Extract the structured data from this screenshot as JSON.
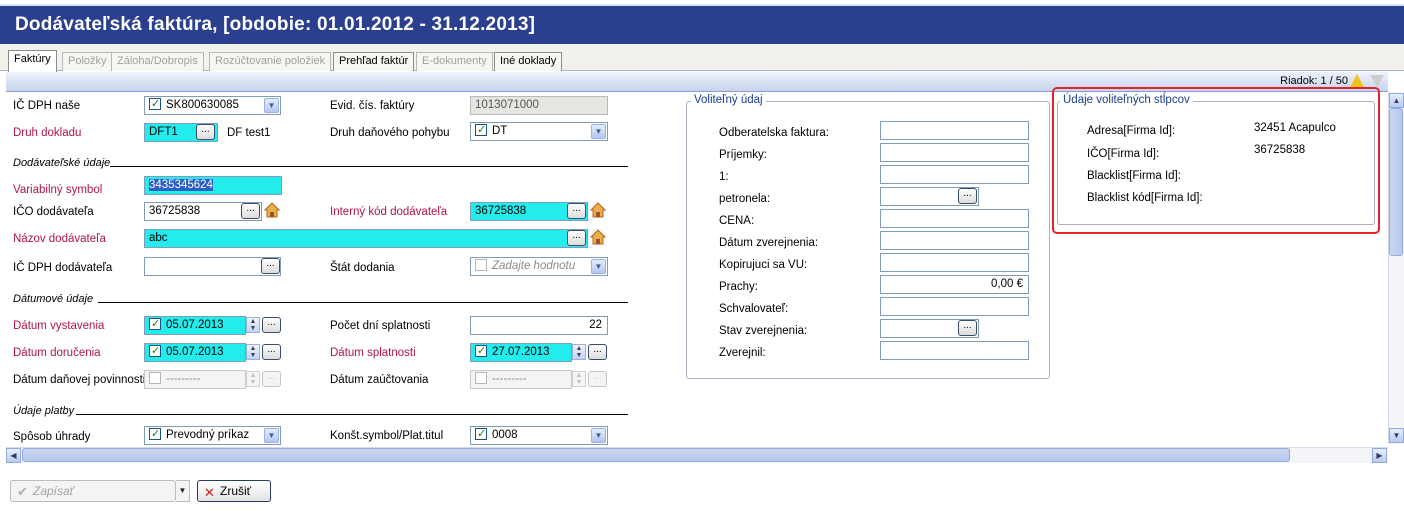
{
  "window": {
    "title": "Dodávateľská faktúra, [obdobie: 01.01.2012 - 31.12.2013]"
  },
  "tabs": [
    {
      "label": "Faktúry",
      "state": "active"
    },
    {
      "label": "Položky",
      "state": "disabled"
    },
    {
      "label": "Záloha/Dobropis",
      "state": "disabled"
    },
    {
      "label": "Rozúčtovanie položiek",
      "state": "disabled"
    },
    {
      "label": "Prehľad faktúr",
      "state": "enabled"
    },
    {
      "label": "E-dokumenty",
      "state": "disabled"
    },
    {
      "label": "Iné doklady",
      "state": "enabled"
    }
  ],
  "toolbar": {
    "row_info": "Riadok: 1 / 50",
    "icons": [
      "warning-icon",
      "filter-icon"
    ]
  },
  "form": {
    "ic_dph_nase": {
      "label": "IČ DPH naše",
      "value": "SK800630085",
      "checked": true
    },
    "evid_cis": {
      "label": "Evid. čís. faktúry",
      "value": "1013071000"
    },
    "druh_dokladu": {
      "label": "Druh dokladu",
      "value": "DFT1",
      "desc": "DF test1"
    },
    "druh_dan_pohybu": {
      "label": "Druh daňového pohybu",
      "value": "DT",
      "checked": true
    },
    "sect_dodavatel": "Dodávateľské údaje",
    "variabilny_symbol": {
      "label": "Variabilný symbol",
      "value": "3435345624"
    },
    "ico_dodavatela": {
      "label": "IČO dodávateľa",
      "value": "36725838"
    },
    "interny_kod": {
      "label": "Interný kód dodávateľa",
      "value": "36725838"
    },
    "nazov_dodavatela": {
      "label": "Názov dodávateľa",
      "value": "abc"
    },
    "ic_dph_dodavatela": {
      "label": "IČ DPH dodávateľa",
      "value": ""
    },
    "stat_dodania": {
      "label": "Štát dodania",
      "placeholder": "Zadajte hodnotu"
    },
    "sect_datum": "Dátumové údaje",
    "datum_vystavenia": {
      "label": "Dátum vystavenia",
      "value": "05.07.2013",
      "checked": true
    },
    "pocet_dni": {
      "label": "Počet dní splatnosti",
      "value": "22"
    },
    "datum_dorucenia": {
      "label": "Dátum doručenia",
      "value": "05.07.2013",
      "checked": true
    },
    "datum_splatnosti": {
      "label": "Dátum splatnosti",
      "value": "27.07.2013",
      "checked": true
    },
    "datum_danovej": {
      "label": "Dátum daňovej povinnosti",
      "value": "---------"
    },
    "datum_zauctovania": {
      "label": "Dátum zaúčtovania",
      "value": "---------"
    },
    "sect_platba": "Údaje platby",
    "sposob_uhrady": {
      "label": "Spôsob úhrady",
      "value": "Prevodný príkaz",
      "checked": true
    },
    "konst_symbol": {
      "label": "Konšt.symbol/Plat.titul",
      "value": "0008",
      "checked": true
    }
  },
  "volitelny": {
    "title": "Voliteľný údaj",
    "rows": [
      {
        "label": "Odberatelska faktura:",
        "value": ""
      },
      {
        "label": "Príjemky:",
        "value": ""
      },
      {
        "label": "1:",
        "value": ""
      },
      {
        "label": "petronela:",
        "value": ""
      },
      {
        "label": "CENA:",
        "value": ""
      },
      {
        "label": "Dátum zverejnenia:",
        "value": ""
      },
      {
        "label": "Kopirujuci sa VU:",
        "value": ""
      },
      {
        "label": "Prachy:",
        "value": "0,00 €"
      },
      {
        "label": "Schvalovateľ:",
        "value": ""
      },
      {
        "label": "Stav zverejnenia:",
        "value": ""
      },
      {
        "label": "Zverejnil:",
        "value": ""
      }
    ]
  },
  "stlpce": {
    "title": "Údaje voliteľných stĺpcov",
    "rows": [
      {
        "label": "Adresa[Firma Id]:",
        "value": "32451 Acapulco"
      },
      {
        "label": "IČO[Firma Id]:",
        "value": "36725838"
      },
      {
        "label": "Blacklist[Firma Id]:",
        "value": ""
      },
      {
        "label": "Blacklist kód[Firma Id]:",
        "value": ""
      }
    ]
  },
  "buttons": {
    "save": "Zapísať",
    "cancel": "Zrušiť"
  },
  "colors": {
    "title_bar": "#2b3f8f",
    "required_label": "#b0154b",
    "highlight_field": "#23ecec",
    "annotation_box": "#e4242a"
  }
}
